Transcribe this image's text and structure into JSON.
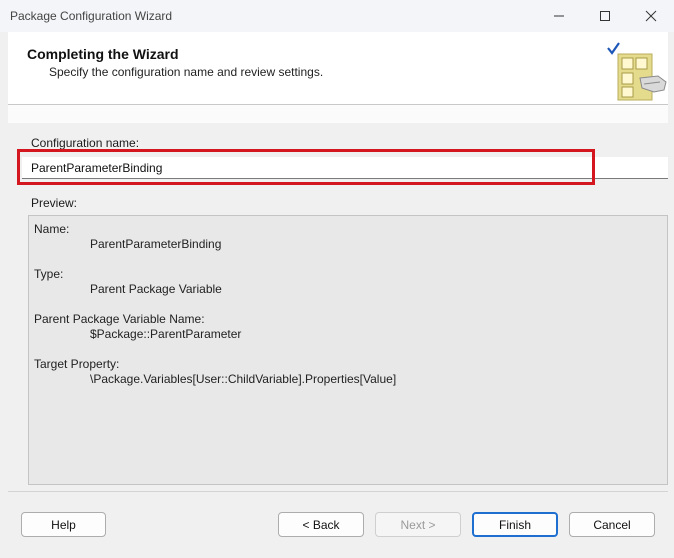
{
  "window": {
    "title": "Package Configuration Wizard",
    "minimize_glyph": "—",
    "maximize_glyph": "☐",
    "close_glyph": "✕"
  },
  "header": {
    "title": "Completing the Wizard",
    "subtitle": "Specify the configuration name and review settings."
  },
  "config": {
    "label": "Configuration name:",
    "value": "ParentParameterBinding"
  },
  "preview": {
    "label": "Preview:",
    "name_key": "Name:",
    "name_value": "ParentParameterBinding",
    "type_key": "Type:",
    "type_value": "Parent Package Variable",
    "parent_var_key": "Parent Package Variable Name:",
    "parent_var_value": "$Package::ParentParameter",
    "target_key": "Target Property:",
    "target_value": "\\Package.Variables[User::ChildVariable].Properties[Value]"
  },
  "buttons": {
    "help": "Help",
    "back": "< Back",
    "next": "Next >",
    "finish": "Finish",
    "cancel": "Cancel"
  },
  "colors": {
    "highlight": "#d4161e",
    "accent": "#1f6fd1"
  },
  "icons": {
    "header": "wizard-checklist-icon"
  }
}
